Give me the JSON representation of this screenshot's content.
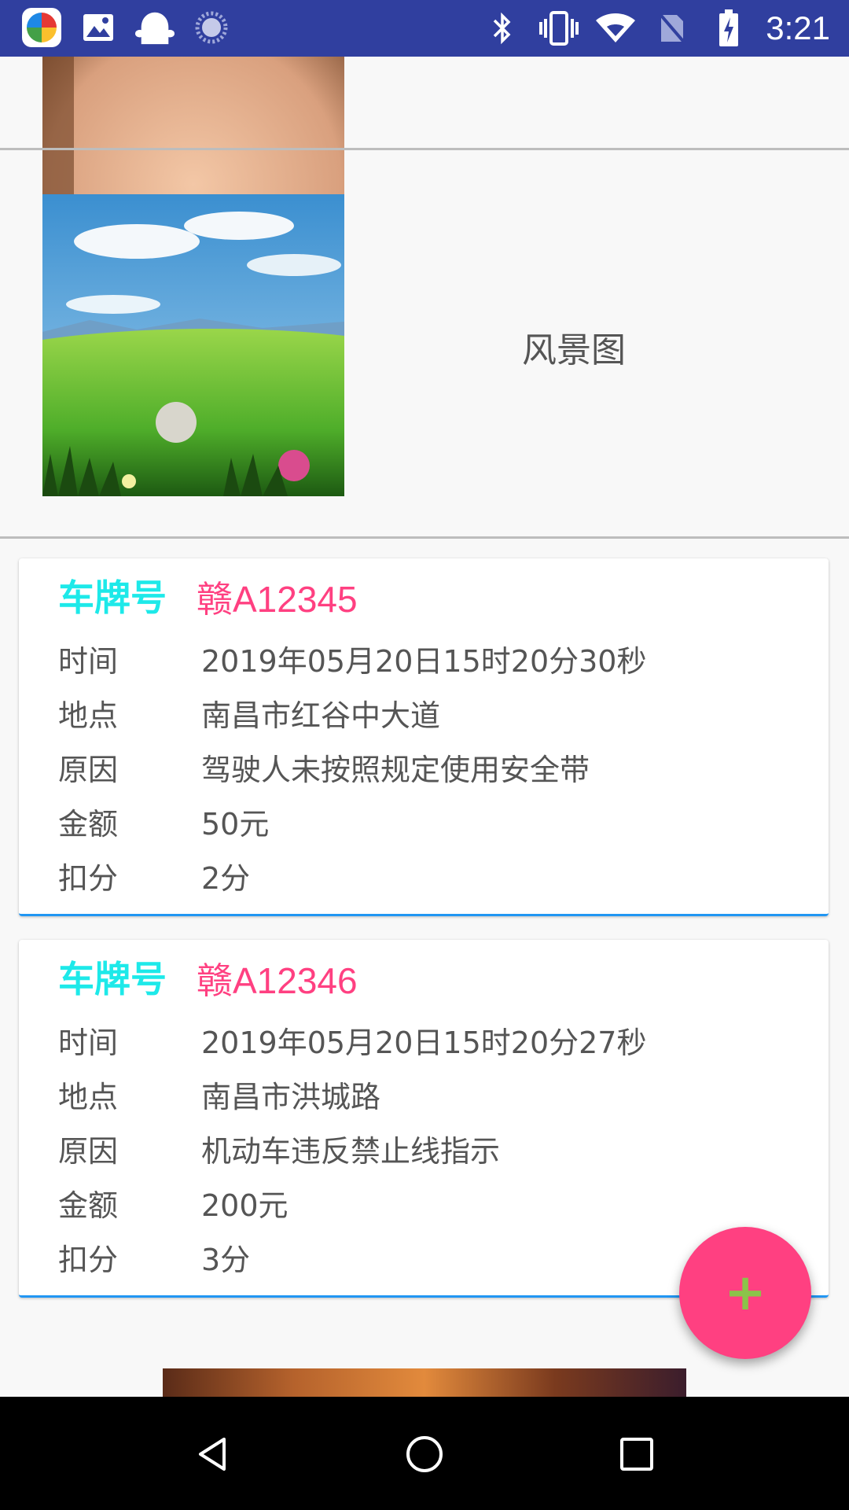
{
  "status_bar": {
    "time": "3:21",
    "left_icons": [
      "app-store-icon",
      "gallery-icon",
      "ghost-icon",
      "loading-icon"
    ],
    "right_icons": [
      "bluetooth-icon",
      "vibrate-icon",
      "wifi-icon",
      "no-sim-icon",
      "battery-charging-icon"
    ]
  },
  "images": [
    {
      "label": ""
    },
    {
      "label": "风景图"
    }
  ],
  "records": [
    {
      "plate_label": "车牌号",
      "plate": "赣A12345",
      "fields": [
        {
          "label": "时间",
          "value": "2019年05月20日15时20分30秒"
        },
        {
          "label": "地点",
          "value": "南昌市红谷中大道"
        },
        {
          "label": "原因",
          "value": "驾驶人未按照规定使用安全带"
        },
        {
          "label": "金额",
          "value": "50元"
        },
        {
          "label": "扣分",
          "value": "2分"
        }
      ]
    },
    {
      "plate_label": "车牌号",
      "plate": "赣A12346",
      "fields": [
        {
          "label": "时间",
          "value": "2019年05月20日15时20分27秒"
        },
        {
          "label": "地点",
          "value": "南昌市洪城路"
        },
        {
          "label": "原因",
          "value": "机动车违反禁止线指示"
        },
        {
          "label": "金额",
          "value": "200元"
        },
        {
          "label": "扣分",
          "value": "3分"
        }
      ]
    }
  ],
  "fab": {
    "label": "+"
  },
  "nav": [
    "back-icon",
    "home-icon",
    "recents-icon"
  ],
  "colors": {
    "status_bar": "#303f9f",
    "plate_label": "#1de9e9",
    "plate_value": "#ff4081",
    "fab": "#ff4081",
    "fab_plus": "#8bc34a",
    "card_underline": "#2196f3"
  }
}
